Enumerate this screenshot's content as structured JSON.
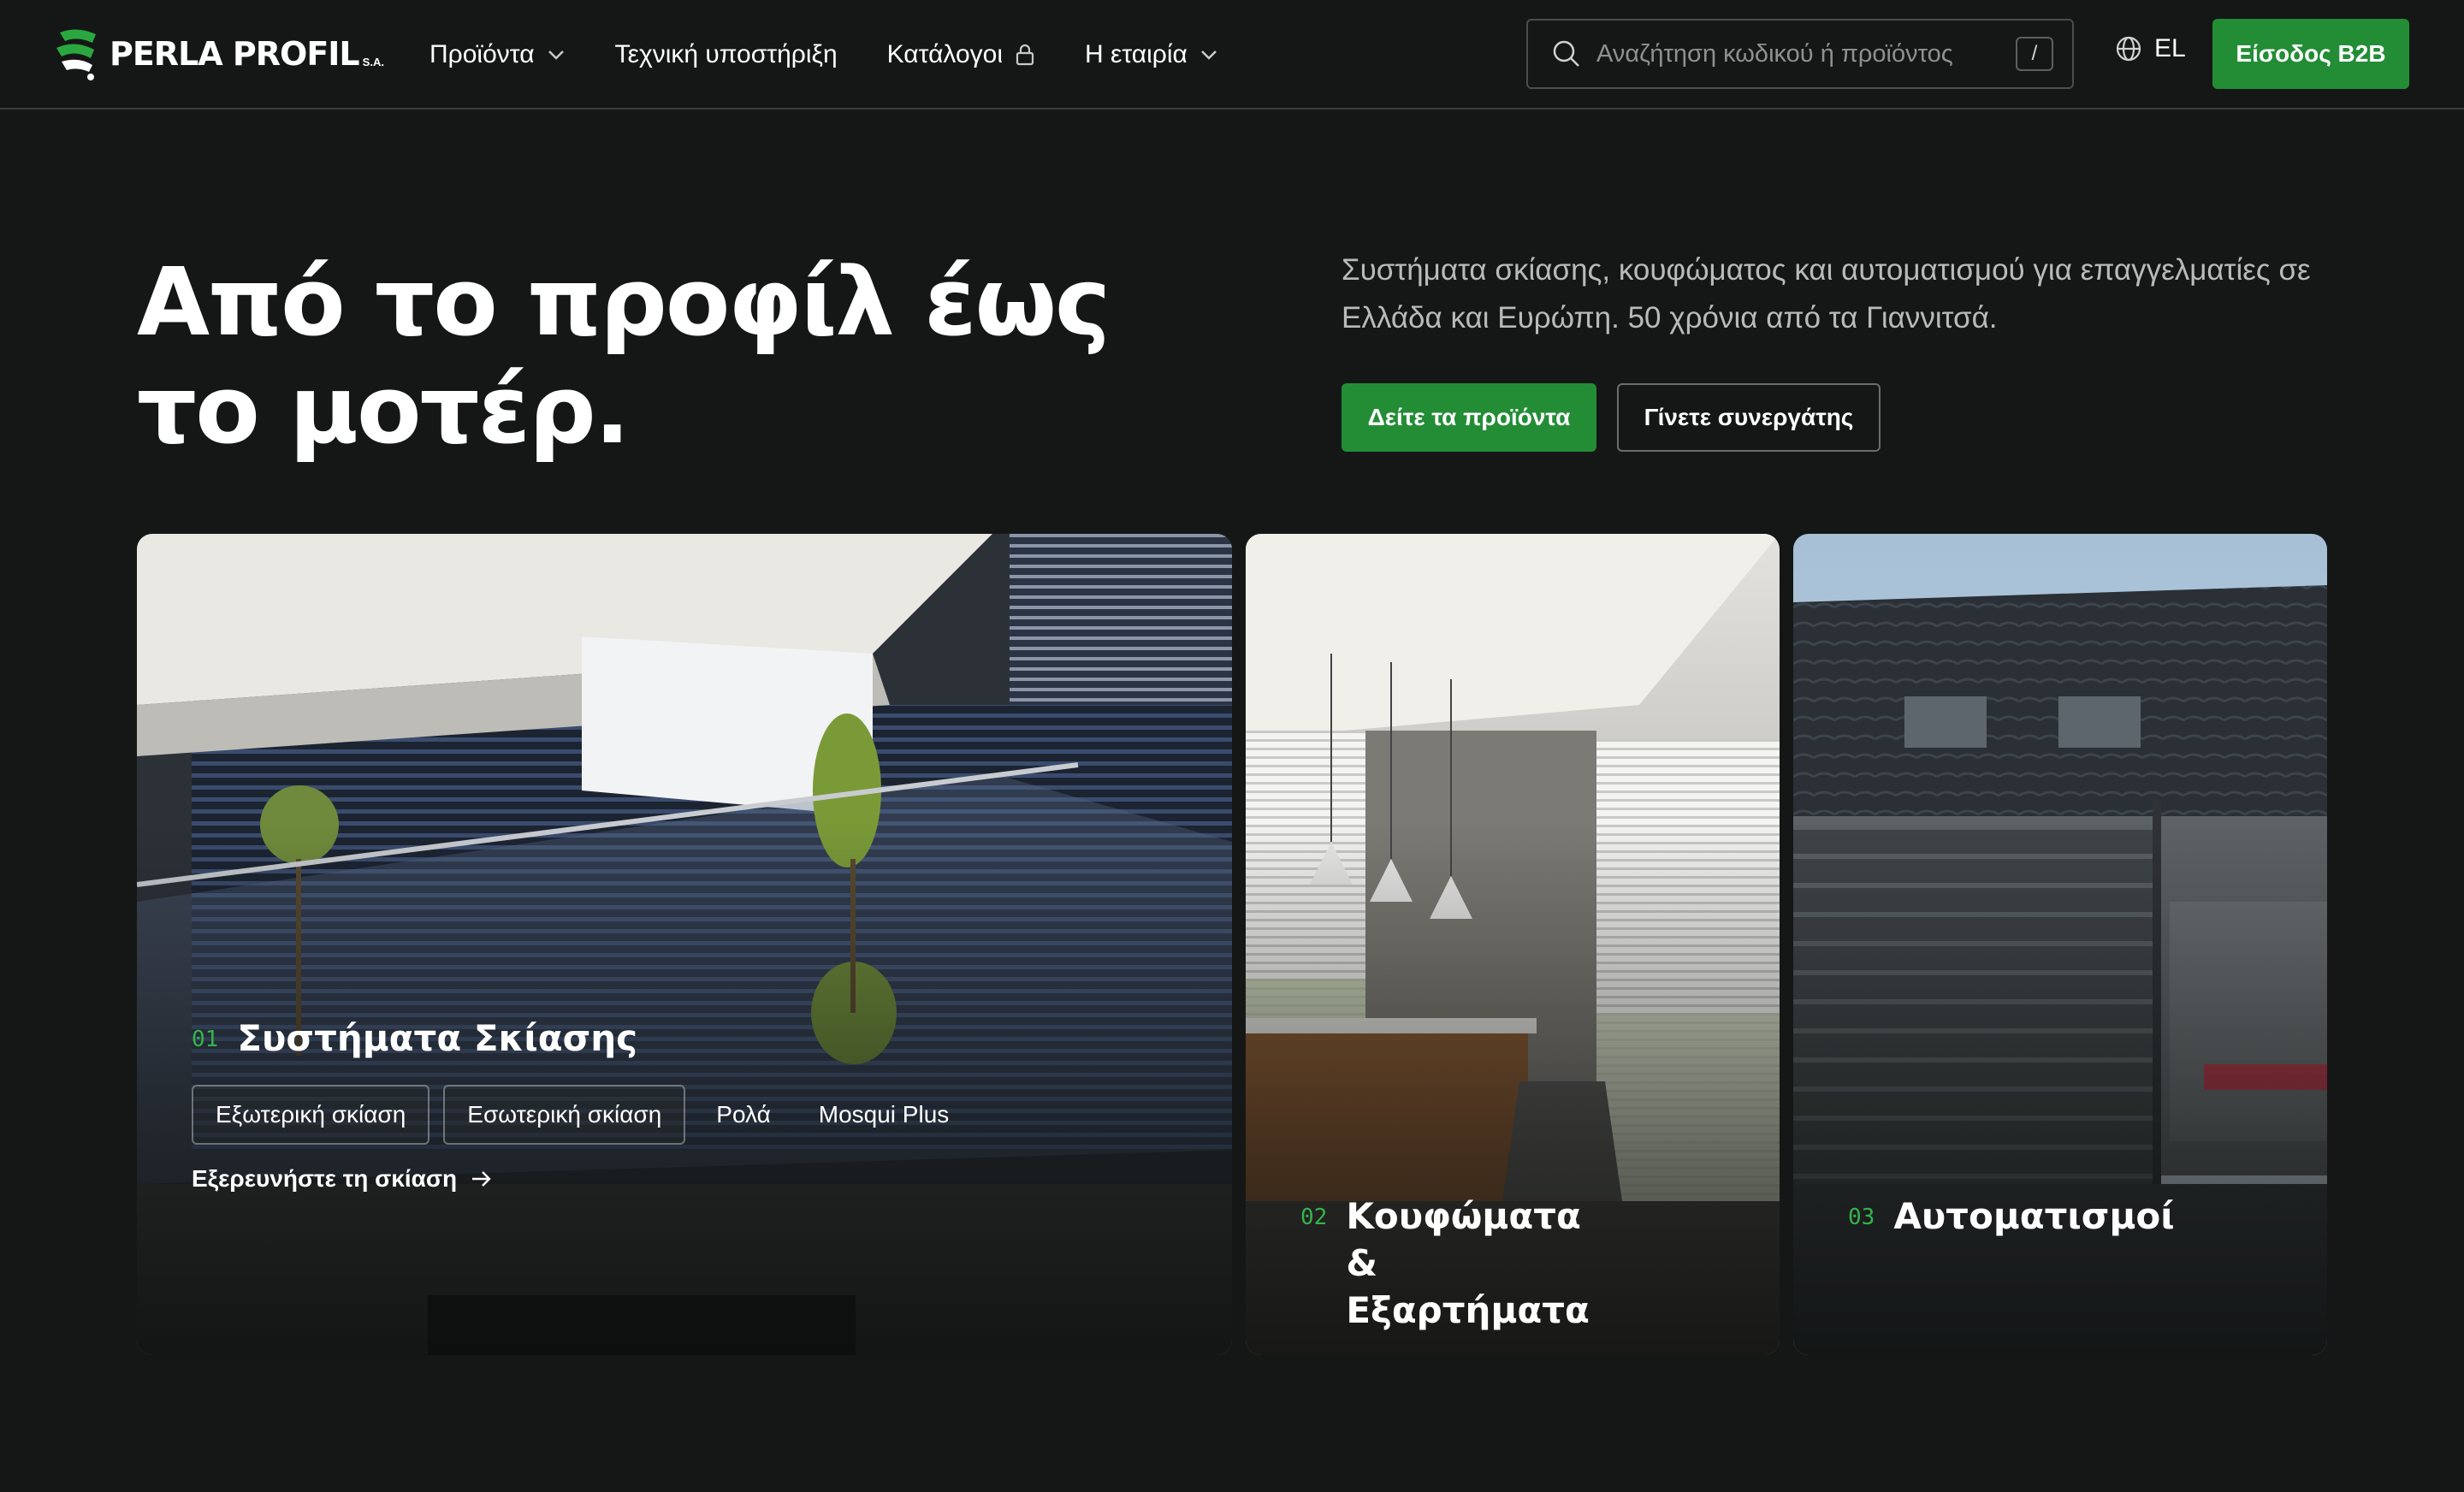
{
  "header": {
    "logo_text": "PERLA PROFIL",
    "logo_suffix": "S.A.",
    "nav": [
      {
        "label": "Προϊόντα",
        "has_dropdown": true
      },
      {
        "label": "Τεχνική υποστήριξη"
      },
      {
        "label": "Κατάλογοι",
        "locked": true
      },
      {
        "label": "Η εταιρία",
        "has_dropdown": true
      }
    ],
    "search": {
      "placeholder": "Αναζήτηση κωδικού ή προϊόντος",
      "shortcut": "/"
    },
    "language": "EL",
    "b2b_label": "Είσοδος B2B"
  },
  "hero": {
    "title": "Από το προφίλ έως το μοτέρ.",
    "description": "Συστήματα σκίασης, κουφώματος και αυτοματισμού για επαγγελματίες σε Ελλάδα και Ευρώπη. 50 χρόνια από τα Γιαννιτσά.",
    "primary_cta": "Δείτε τα προϊόντα",
    "secondary_cta": "Γίνετε συνεργάτης"
  },
  "cards": [
    {
      "number": "01",
      "title": "Συστήματα Σκίασης",
      "chips": [
        "Εξωτερική σκίαση",
        "Εσωτερική σκίαση",
        "Ρολά",
        "Mosqui Plus"
      ],
      "link": "Εξερευνήστε τη σκίαση"
    },
    {
      "number": "02",
      "title": "Κουφώματα & Εξαρτήματα"
    },
    {
      "number": "03",
      "title": "Αυτοματισμοί"
    }
  ],
  "colors": {
    "background": "#151716",
    "accent": "#238d36",
    "accent_text": "#35b34a"
  },
  "icons": [
    "logo-mark-icon",
    "chevron-down-icon",
    "lock-icon",
    "search-icon",
    "globe-icon",
    "arrow-right-icon"
  ]
}
